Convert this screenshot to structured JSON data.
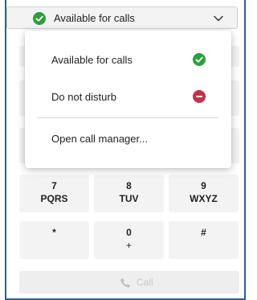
{
  "status": {
    "label": "Available for calls",
    "color": "#2e9e3e"
  },
  "menu": {
    "items": [
      {
        "label": "Available for calls",
        "icon": "check-circle-icon",
        "color": "#2e9e3e"
      },
      {
        "label": "Do not disturb",
        "icon": "minus-circle-icon",
        "color": "#c4314b"
      }
    ],
    "action_label": "Open call manager..."
  },
  "keypad": {
    "keys": [
      {
        "digit": "7",
        "letters": "PQRS"
      },
      {
        "digit": "8",
        "letters": "TUV"
      },
      {
        "digit": "9",
        "letters": "WXYZ"
      },
      {
        "digit": "*",
        "letters": ""
      },
      {
        "digit": "0",
        "letters": "+"
      },
      {
        "digit": "#",
        "letters": ""
      }
    ]
  },
  "call": {
    "label": "Call"
  }
}
